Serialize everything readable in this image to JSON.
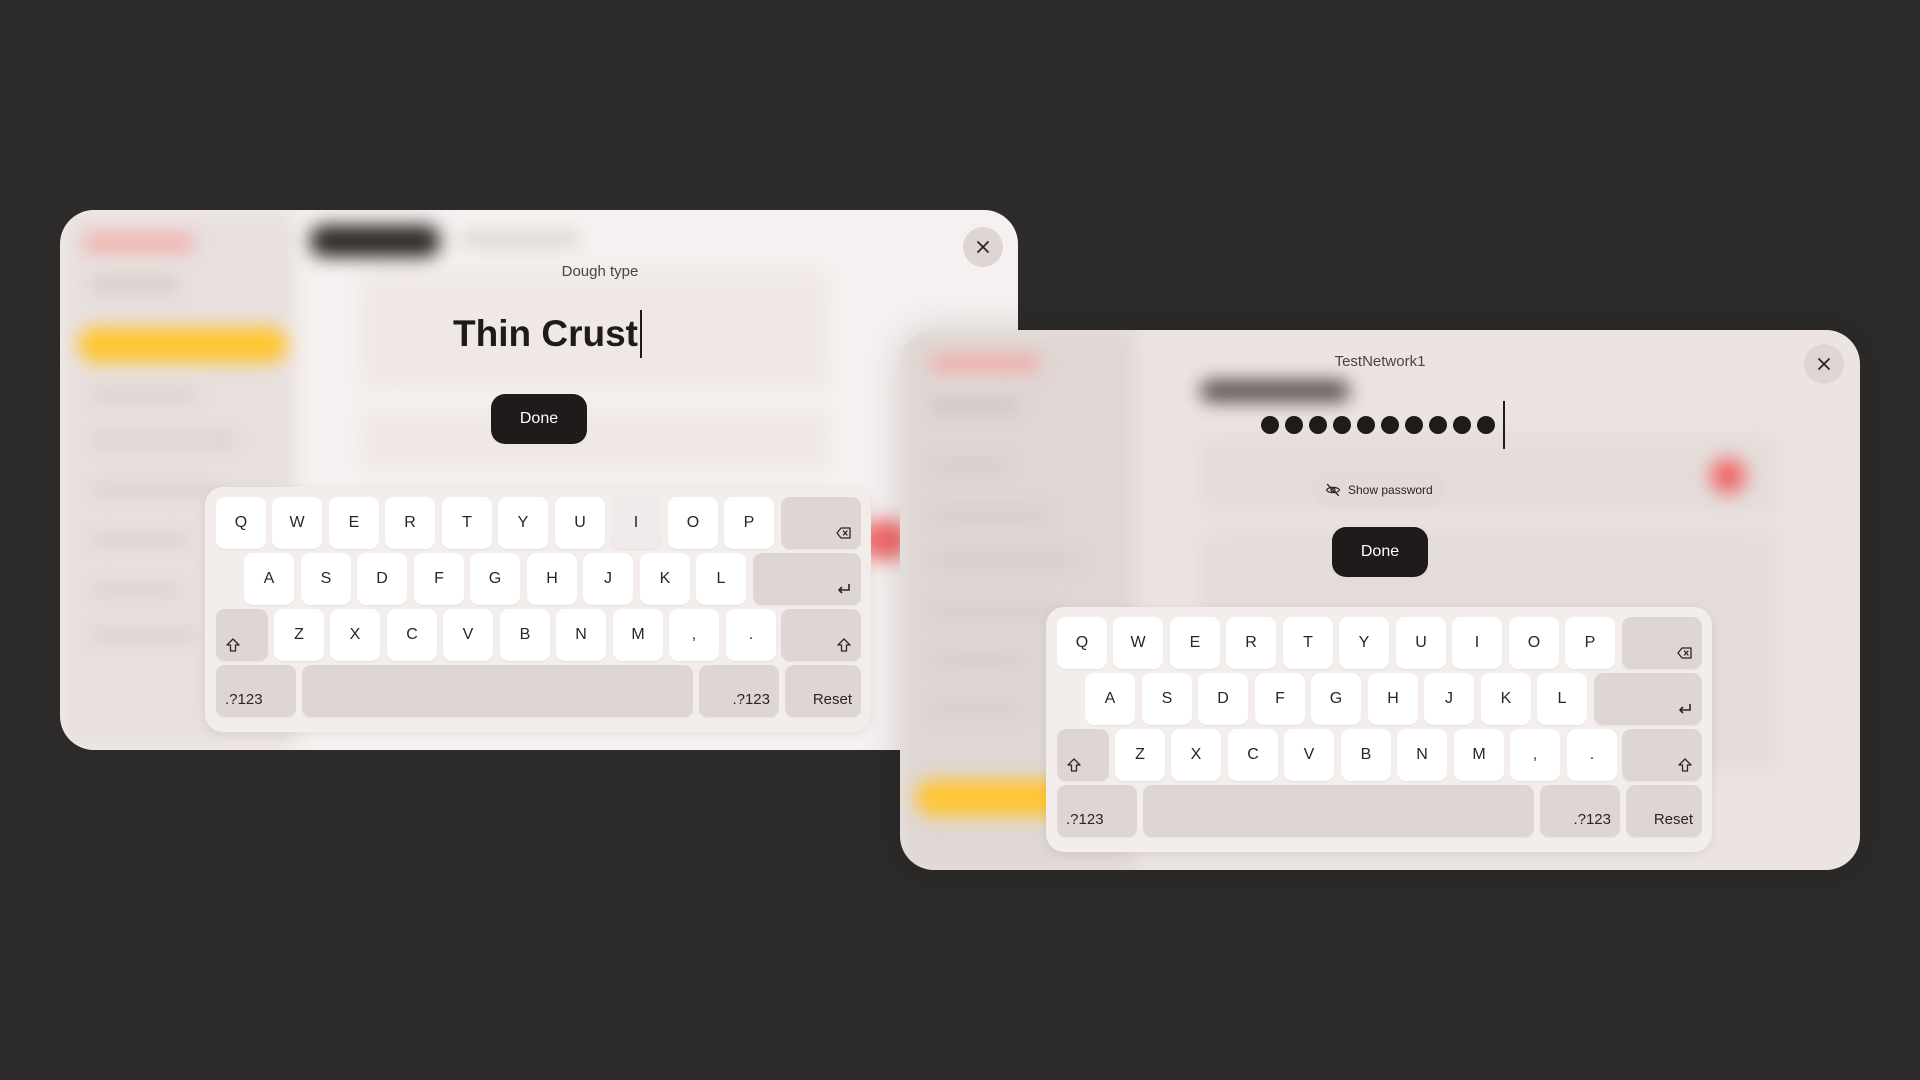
{
  "dough_dialog": {
    "field_label": "Dough type",
    "value": "Thin Crust",
    "done_label": "Done",
    "keyboard": {
      "row1": [
        "Q",
        "W",
        "E",
        "R",
        "T",
        "Y",
        "U",
        "I",
        "O",
        "P"
      ],
      "row2": [
        "A",
        "S",
        "D",
        "F",
        "G",
        "H",
        "J",
        "K",
        "L"
      ],
      "row3": [
        "Z",
        "X",
        "C",
        "V",
        "B",
        "N",
        "M",
        ",",
        "."
      ],
      "symbols_left": ".?123",
      "symbols_right": ".?123",
      "reset_label": "Reset"
    }
  },
  "network_dialog": {
    "network_name": "TestNetwork1",
    "password_masked_length": 10,
    "show_password_label": "Show password",
    "done_label": "Done",
    "keyboard": {
      "row1": [
        "Q",
        "W",
        "E",
        "R",
        "T",
        "Y",
        "U",
        "I",
        "O",
        "P"
      ],
      "row2": [
        "A",
        "S",
        "D",
        "F",
        "G",
        "H",
        "J",
        "K",
        "L"
      ],
      "row3": [
        "Z",
        "X",
        "C",
        "V",
        "B",
        "N",
        "M",
        ",",
        "."
      ],
      "symbols_left": ".?123",
      "symbols_right": ".?123",
      "reset_label": "Reset"
    }
  },
  "icons": {
    "close": "close-icon",
    "backspace": "backspace-icon",
    "enter": "enter-icon",
    "shift": "shift-icon",
    "eye_off": "eye-off-icon"
  },
  "colors": {
    "background": "#2c2b29",
    "accent_yellow": "#ffc531",
    "accent_red": "#f06a6a",
    "dark_button": "#1e1b1a"
  }
}
